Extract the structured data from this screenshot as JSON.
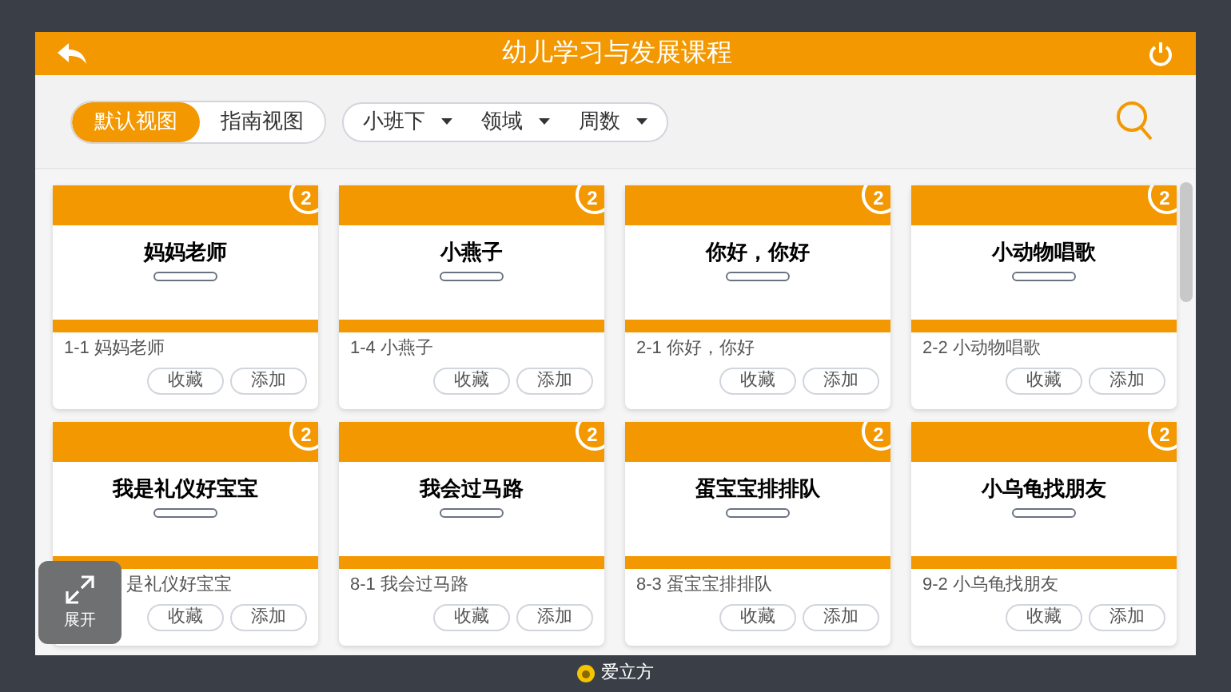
{
  "header": {
    "title": "幼儿学习与发展课程"
  },
  "view_tabs": [
    {
      "label": "默认视图",
      "selected": true
    },
    {
      "label": "指南视图",
      "selected": false
    }
  ],
  "filters": [
    {
      "label": "小班下"
    },
    {
      "label": "领域"
    },
    {
      "label": "周数"
    }
  ],
  "cards": [
    {
      "thumbnail_title": "妈妈老师",
      "badge": "2",
      "label": "1-1 妈妈老师",
      "buttons": [
        "收藏",
        "添加"
      ]
    },
    {
      "thumbnail_title": "小燕子",
      "badge": "2",
      "label": "1-4 小燕子",
      "buttons": [
        "收藏",
        "添加"
      ]
    },
    {
      "thumbnail_title": "你好，你好",
      "badge": "2",
      "label": "2-1 你好，你好",
      "buttons": [
        "收藏",
        "添加"
      ]
    },
    {
      "thumbnail_title": "小动物唱歌",
      "badge": "2",
      "label": "2-2 小动物唱歌",
      "buttons": [
        "收藏",
        "添加"
      ]
    },
    {
      "thumbnail_title": "我是礼仪好宝宝",
      "badge": "2",
      "label": "是礼仪好宝宝",
      "buttons": [
        "收藏",
        "添加"
      ]
    },
    {
      "thumbnail_title": "我会过马路",
      "badge": "2",
      "label": "8-1 我会过马路",
      "buttons": [
        "收藏",
        "添加"
      ]
    },
    {
      "thumbnail_title": "蛋宝宝排排队",
      "badge": "2",
      "label": "8-3 蛋宝宝排排队",
      "buttons": [
        "收藏",
        "添加"
      ]
    },
    {
      "thumbnail_title": "小乌龟找朋友",
      "badge": "2",
      "label": "9-2 小乌龟找朋友",
      "buttons": [
        "收藏",
        "添加"
      ]
    }
  ],
  "expand_button": {
    "label": "展开"
  },
  "footer": {
    "brand": "爱立方"
  }
}
